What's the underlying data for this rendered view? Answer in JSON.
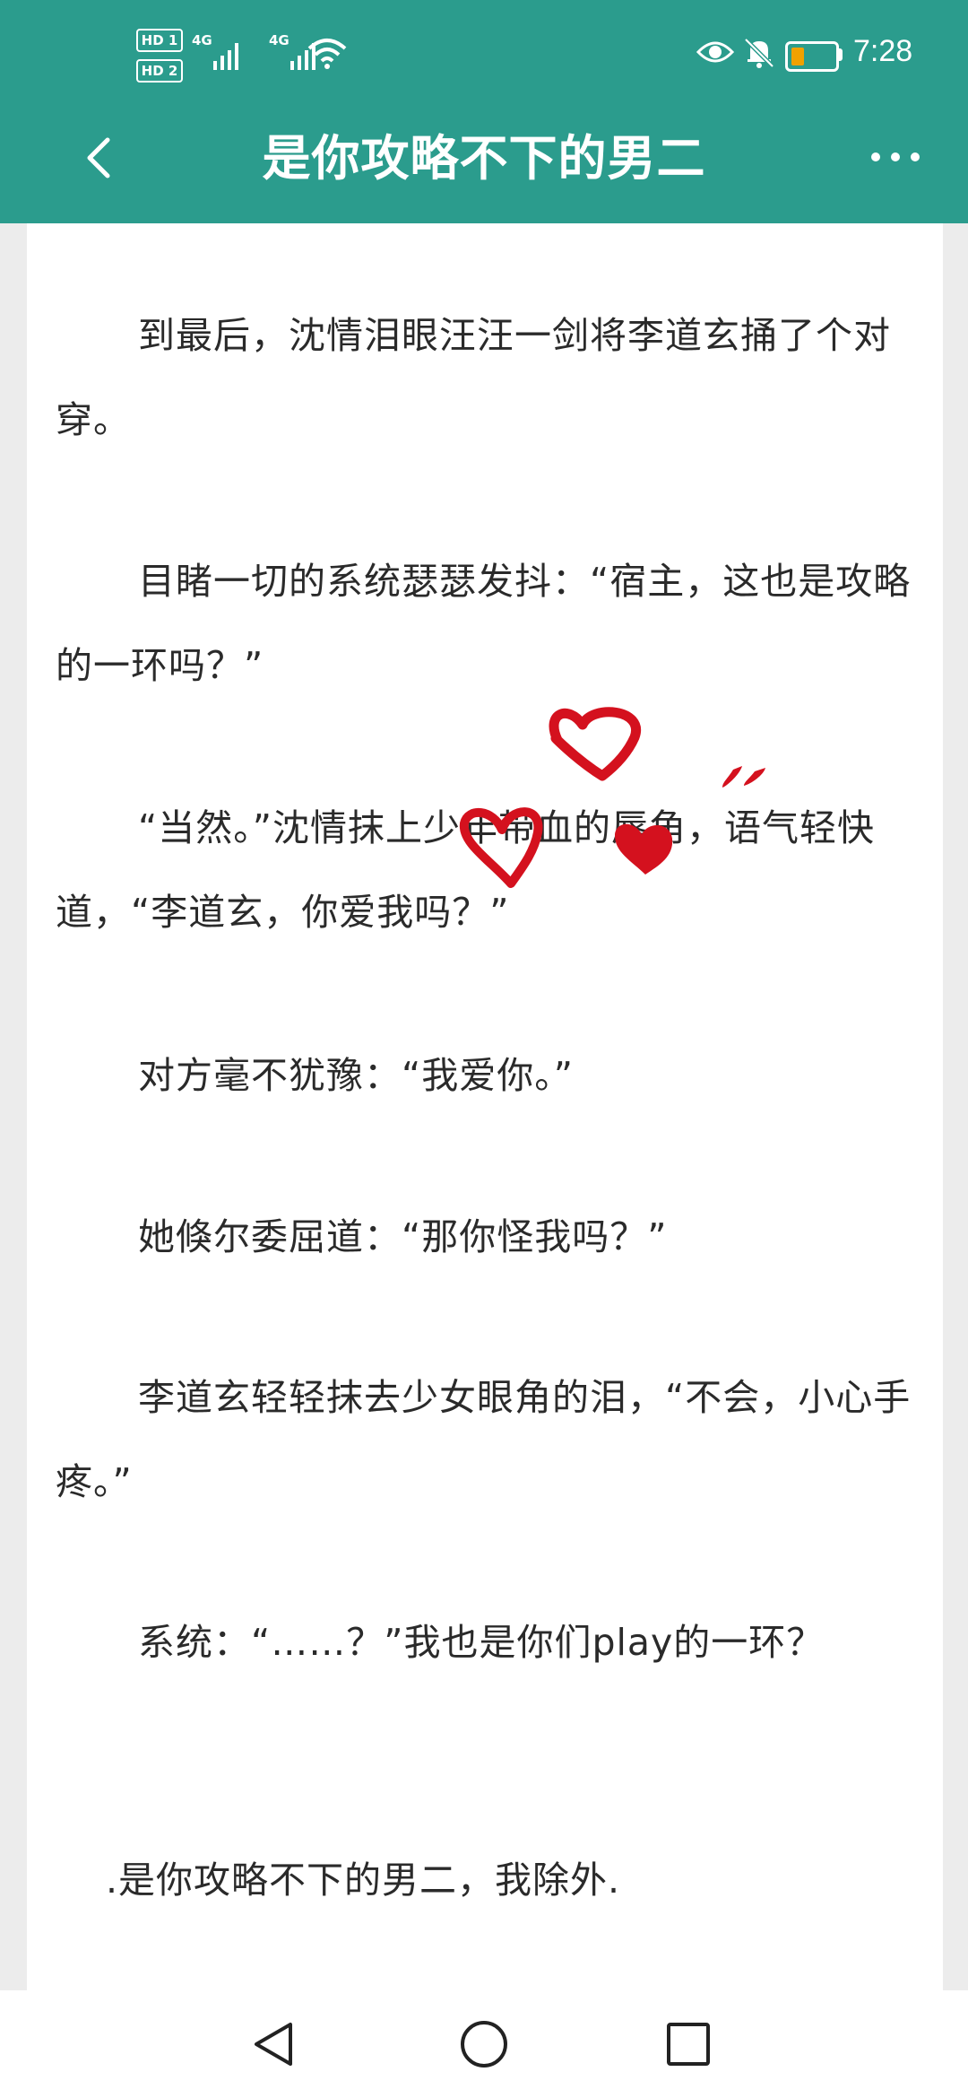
{
  "status_bar": {
    "sim1": "HD 1",
    "sim2": "HD 2",
    "network1": "4G",
    "network2": "4G",
    "time": "7:28",
    "icons": [
      "signal-icon",
      "wifi-icon",
      "eye-icon",
      "bell-muted-icon",
      "battery-icon"
    ]
  },
  "header": {
    "title": "是你攻略不下的男二",
    "back_icon": "chevron-left-icon",
    "more_icon": "more-dots-icon"
  },
  "content": {
    "paragraphs": [
      "到最后，沈情泪眼汪汪一剑将李道玄捅了个对穿。",
      "目睹一切的系统瑟瑟发抖：“宿主，这也是攻略的一环吗？”",
      "“当然。”沈情抹上少年带血的唇角，语气轻快道，“李道玄，你爱我吗？”",
      "对方毫不犹豫：“我爱你。”",
      "她倏尔委屈道：“那你怪我吗？”",
      "李道玄轻轻抹去少女眼角的泪，“不会，小心手疼。”",
      "系统：“……？”我也是你们play的一环？"
    ],
    "footer_line": ".是你攻略不下的男二，我除外."
  },
  "nav_bar": {
    "icons": [
      "back-triangle-icon",
      "home-circle-icon",
      "recents-square-icon"
    ]
  },
  "colors": {
    "header_bg": "#2b9c8d",
    "doodle": "#d4111e",
    "battery": "#f1a100"
  }
}
